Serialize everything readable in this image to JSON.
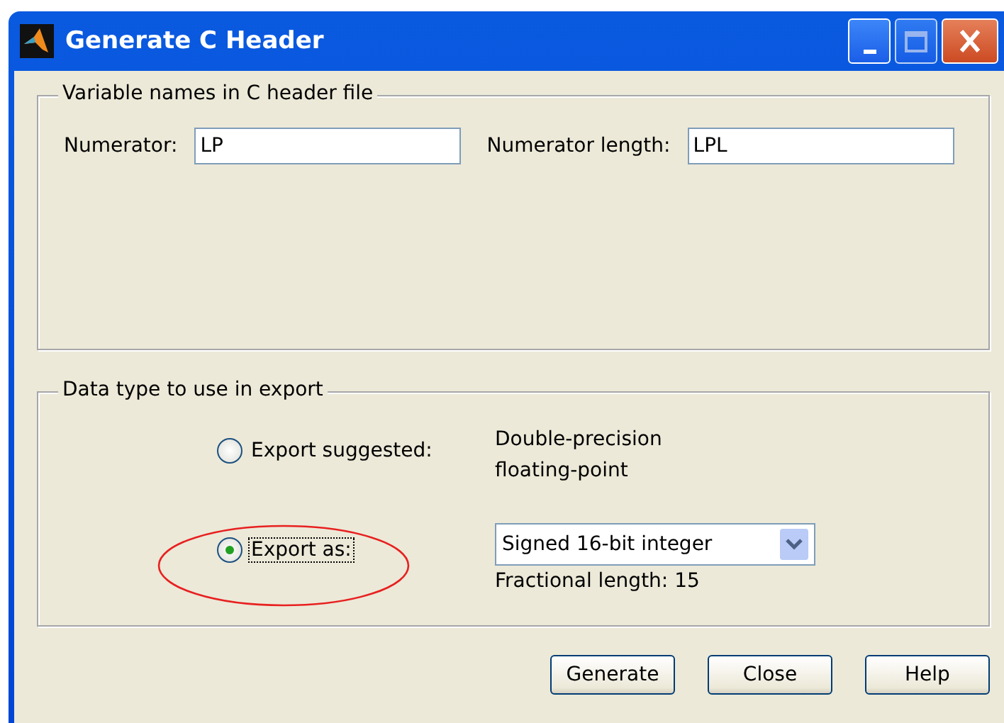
{
  "window": {
    "title": "Generate C Header"
  },
  "variable_names": {
    "legend": "Variable names in C header file",
    "fields": [
      {
        "label": "Numerator:",
        "value": "LP"
      },
      {
        "label": "Numerator length:",
        "value": "LPL"
      }
    ]
  },
  "data_type": {
    "legend": "Data type to use in export",
    "options": [
      {
        "kind": "note",
        "label": "Export suggested:",
        "selected": false,
        "focused": false,
        "lines": [
          "Double-precision",
          "floating-point"
        ]
      },
      {
        "kind": "dropdown",
        "label": "Export as:",
        "selected": true,
        "focused": true,
        "value": "Signed 16-bit integer",
        "detail": "Fractional length: 15"
      }
    ]
  },
  "buttons": [
    "Generate",
    "Close",
    "Help"
  ]
}
